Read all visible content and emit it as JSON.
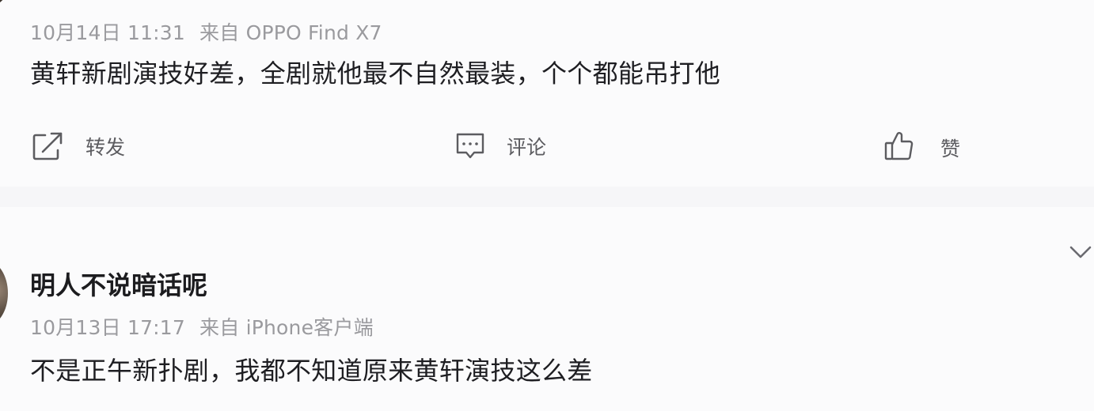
{
  "posts": [
    {
      "date": "10月14日 11:31",
      "source": "来自 OPPO Find X7",
      "content": "黄轩新剧演技好差，全剧就他最不自然最装，个个都能吊打他",
      "actions": {
        "forward_label": "转发",
        "comment_label": "评论",
        "like_label": "赞"
      }
    },
    {
      "username": "明人不说暗话呢",
      "date": "10月13日 17:17",
      "source": "来自 iPhone客户端",
      "content": "不是正午新扑剧，我都不知道原来黄轩演技这么差"
    }
  ],
  "icons": {
    "forward": "share-icon",
    "comment": "comment-icon",
    "like": "thumbs-up-icon",
    "expand": "chevron-down-icon"
  },
  "colors": {
    "page_background": "#f6f6f8",
    "card_background": "#fbfbfc",
    "meta_text": "#9a9a9e",
    "body_text": "#1e1e22",
    "action_text": "#5c5c60"
  }
}
